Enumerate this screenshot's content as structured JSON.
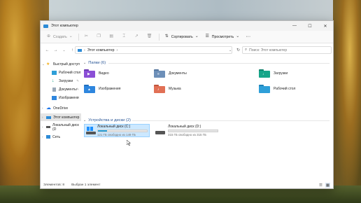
{
  "window": {
    "title": "Этот компьютер",
    "controls": {
      "minimize": "—",
      "maximize": "☐",
      "close": "✕"
    }
  },
  "ribbon": {
    "create": "Создать",
    "sort": "Сортировать",
    "view": "Просмотреть",
    "more": "···"
  },
  "address": {
    "path": "Этот компьютер",
    "search_placeholder": "Поиск: Этот компьютер"
  },
  "sidebar": {
    "items": [
      {
        "label": "Быстрый доступ",
        "pinned": false
      },
      {
        "label": "Рабочий стол",
        "pinned": true
      },
      {
        "label": "Загрузки",
        "pinned": true
      },
      {
        "label": "Документы",
        "pinned": true
      },
      {
        "label": "Изображени",
        "pinned": true
      },
      {
        "label": "OneDrive",
        "pinned": false
      },
      {
        "label": "Этот компьютер",
        "pinned": false
      },
      {
        "label": "Локальный диск (D",
        "pinned": false
      },
      {
        "label": "Сеть",
        "pinned": false
      }
    ]
  },
  "groups": {
    "folders_header": "Папки (6)",
    "drives_header": "Устройства и диски (2)"
  },
  "folders": [
    {
      "name": "Видео",
      "color": "#8b4fd6"
    },
    {
      "name": "Документы",
      "color": "#6d8fb8"
    },
    {
      "name": "Загрузки",
      "color": "#17a589"
    },
    {
      "name": "Изображения",
      "color": "#2e86de"
    },
    {
      "name": "Музыка",
      "color": "#e17055"
    },
    {
      "name": "Рабочий стол",
      "color": "#2e9fd8"
    }
  ],
  "drives": [
    {
      "name": "Локальный диск (C:)",
      "free": "121 ГБ свободно из 149 ГБ",
      "used_fraction": 0.19,
      "selected": true
    },
    {
      "name": "Локальный диск (D:)",
      "free": "315 ГБ свободно из 315 ГБ",
      "used_fraction": 0.0,
      "selected": false
    }
  ],
  "status": {
    "items": "Элементов: 8",
    "selected": "Выбран 1 элемент"
  },
  "colors": {
    "accent": "#26a0da",
    "header": "#2b5797",
    "selection": "#cce8ff"
  }
}
